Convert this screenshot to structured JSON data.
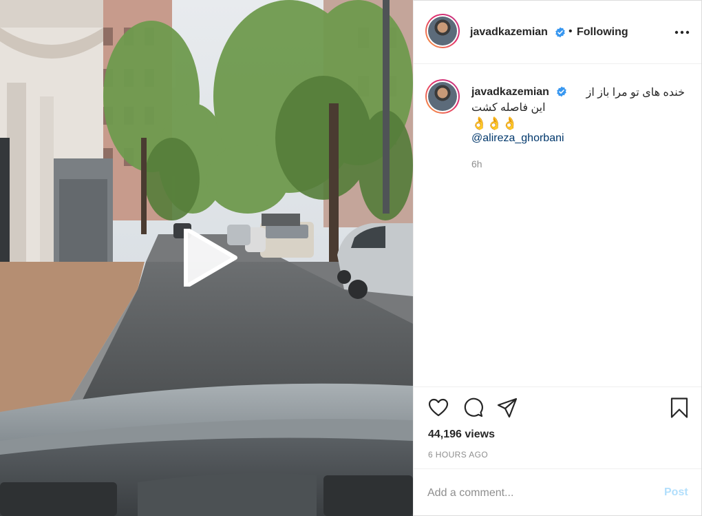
{
  "post": {
    "media": {
      "type": "video",
      "play_icon": "play-icon",
      "scene": "street-view-from-car-windshield"
    },
    "header": {
      "username": "javadkazemian",
      "verified_icon": "verified-badge-icon",
      "separator": "•",
      "follow_status": "Following",
      "more_icon": "more-horizontal-icon"
    },
    "caption": {
      "username": "javadkazemian",
      "line1": "خنده های تو مرا باز از",
      "line2": "این فاصله کشت",
      "emoji": "👌👌👌",
      "mention": "@alireza_ghorbani",
      "time": "6h"
    },
    "actions": {
      "like_icon": "heart-icon",
      "comment_icon": "comment-icon",
      "share_icon": "share-icon",
      "save_icon": "bookmark-icon"
    },
    "stats": {
      "views": "44,196 views",
      "age": "6 HOURS AGO"
    },
    "comment_form": {
      "placeholder": "Add a comment...",
      "post_label": "Post"
    },
    "colors": {
      "text": "#262626",
      "secondary": "#8e8e8e",
      "verified": "#3897f0",
      "mention": "#00376b",
      "post_disabled": "#b2dffc"
    }
  }
}
